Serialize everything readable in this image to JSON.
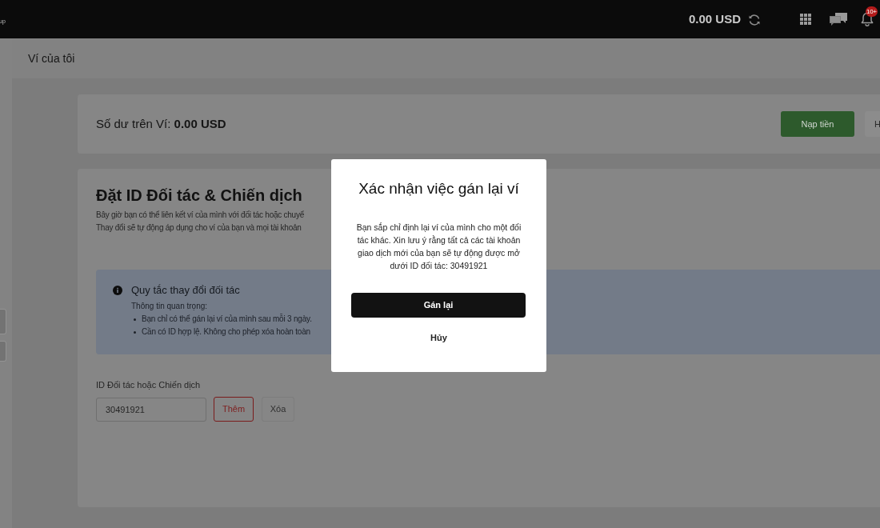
{
  "top_bar": {
    "logo_text": "up",
    "balance": "0.00 USD",
    "notification_badge": "10+"
  },
  "page_header": {
    "title": "Ví của tôi"
  },
  "balance_card": {
    "label": "Số dư trên Ví: **0.00 USD**",
    "buttons": [
      {
        "label": "Nạp tiền",
        "kind": "primary"
      },
      {
        "label": "H",
        "kind": "secondary"
      }
    ]
  },
  "partner_card": {
    "title": "Đặt ID Đối tác & Chiến dịch",
    "description": [
      "Bây giờ bạn có thể liên kết ví của mình với đối tác hoặc chuyể",
      "Thay đổi sẽ tự động áp dụng cho ví của bạn và mọi tài khoản"
    ],
    "info": {
      "title": "Quy tắc thay đổi đối tác",
      "subtitle": "Thông tin quan trọng:",
      "bullets": [
        "Bạn chỉ có thể gán lại ví của mình sau mỗi 3 ngày.",
        "Cần có ID hợp lệ. Không cho phép xóa hoàn toàn"
      ]
    },
    "field": {
      "label": "ID Đối tác hoặc Chiến dịch",
      "value": "30491921"
    },
    "buttons": [
      {
        "label": "Thêm",
        "kind": "danger_outline"
      },
      {
        "label": "Xóa",
        "kind": "outline"
      }
    ]
  },
  "modal": {
    "title": "Xác nhận việc gán lại ví",
    "message": "Bạn sắp chỉ định lại ví của mình cho một đối tác khác. Xin lưu ý rằng tất cả các tài khoản giao dịch mới của bạn sẽ tự động được mở dưới ID đối tác: 30491921",
    "confirm_button": "Gán lại",
    "cancel_button": "Hủy"
  }
}
